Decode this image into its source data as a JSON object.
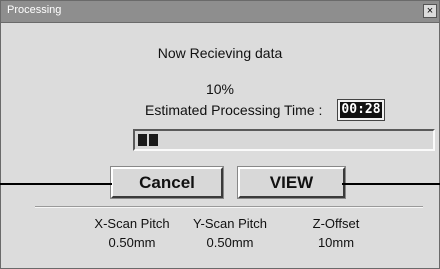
{
  "window": {
    "title": "Processing",
    "close_label": "×"
  },
  "status": {
    "message": "Now Recieving data",
    "percent": "10%",
    "estimate_label": "Estimated Processing Time :",
    "estimate_value": "00:28"
  },
  "progress": {
    "value_percent": 10,
    "segments": 2
  },
  "buttons": {
    "cancel_label": "Cancel",
    "view_label": "VIEW"
  },
  "params": [
    {
      "label": "X-Scan Pitch",
      "value": "0.50mm"
    },
    {
      "label": "Y-Scan Pitch",
      "value": "0.50mm"
    },
    {
      "label": "Z-Offset",
      "value": "10mm"
    }
  ],
  "colors": {
    "titlebar": "#8e8e8e",
    "dialog_bg": "#dcdcdc",
    "progress_fill": "#1a1a1a",
    "time_display_bg": "#111111"
  }
}
